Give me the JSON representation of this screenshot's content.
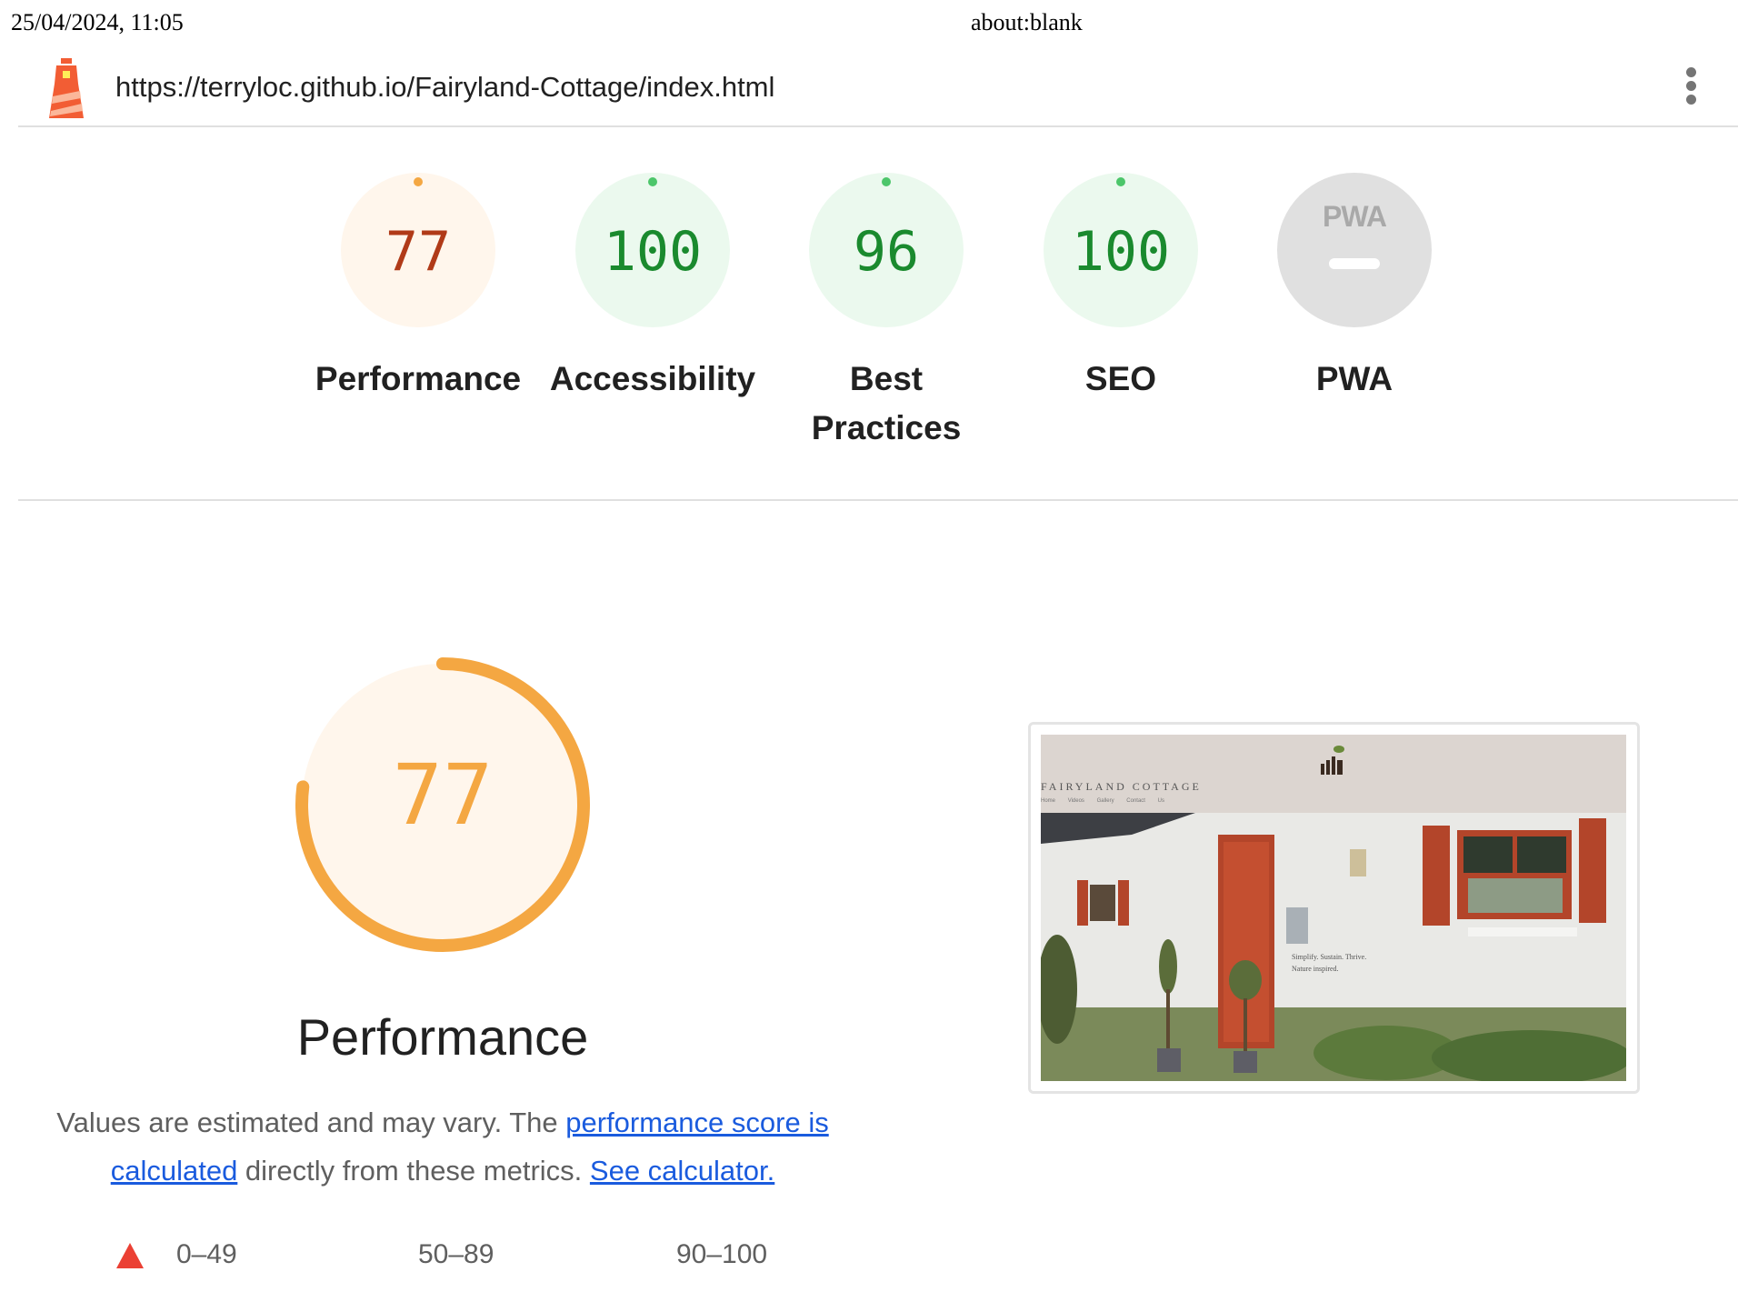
{
  "print_header": {
    "datetime": "25/04/2024, 11:05",
    "title": "about:blank"
  },
  "report": {
    "url": "https://terryloc.github.io/Fairyland-Cottage/index.html"
  },
  "gauges": [
    {
      "label": "Performance",
      "score": "77",
      "rating": "average"
    },
    {
      "label": "Accessibility",
      "score": "100",
      "rating": "pass"
    },
    {
      "label": "Best Practices",
      "score": "96",
      "rating": "pass"
    },
    {
      "label": "SEO",
      "score": "100",
      "rating": "pass"
    },
    {
      "label": "PWA",
      "score": "",
      "badge_text": "PWA",
      "rating": "na"
    }
  ],
  "performance": {
    "score": "77",
    "score_fraction": 0.77,
    "title": "Performance",
    "desc_prefix": "Values are estimated and may vary. The ",
    "link1": "performance score is calculated",
    "desc_middle": " directly from these metrics. ",
    "link2": "See calculator."
  },
  "legend": [
    "0–49",
    "50–89",
    "90–100"
  ],
  "screenshot": {
    "site_name": "FAIRYLAND COTTAGE",
    "nav": [
      "Home",
      "Videos",
      "Gallery",
      "Contact Us"
    ],
    "tagline_1": "Simplify. Sustain. Thrive.",
    "tagline_2": "Nature inspired."
  },
  "colors": {
    "average": "#f4a742",
    "pass": "#4cc66a",
    "fail": "#eb4034",
    "link": "#1a5bde"
  },
  "icons": [
    "lighthouse-logo-icon",
    "more-vert-icon",
    "fail-triangle-icon"
  ]
}
